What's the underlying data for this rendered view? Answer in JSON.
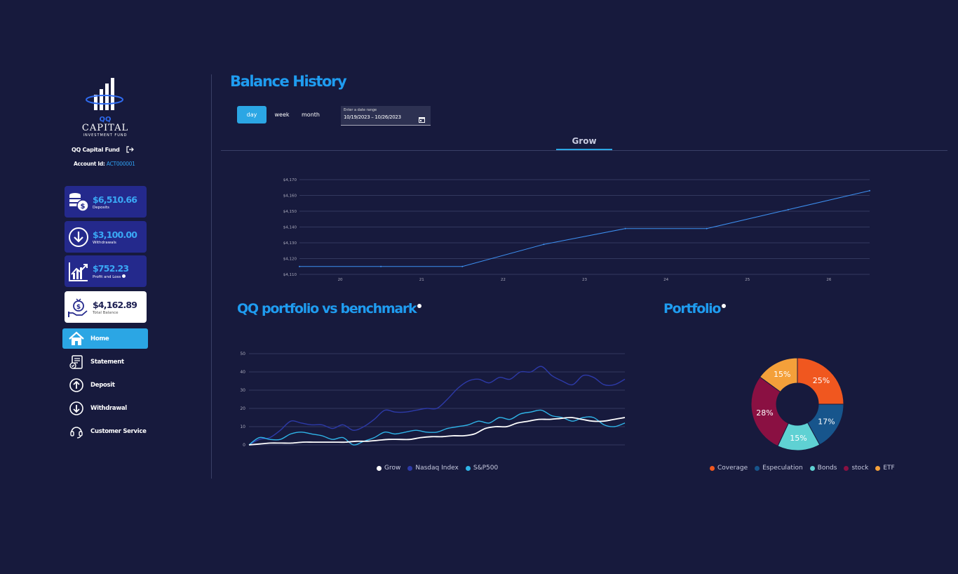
{
  "sidebar": {
    "brand_main": "CAPITAL",
    "brand_sub": "INVESTMENT FUND",
    "logo_letters": "QQ",
    "fund_name": "QQ Capital Fund",
    "account_label": "Account Id:",
    "account_id": "ACT000001",
    "stats": [
      {
        "amount": "$6,510.66",
        "label": "Deposits",
        "icon": "coins-dollar-icon"
      },
      {
        "amount": "$3,100.00",
        "label": "Withdrawals",
        "icon": "download-circle-icon"
      },
      {
        "amount": "$752.23",
        "label": "Profit and Loss",
        "icon": "growth-chart-icon"
      },
      {
        "amount": "$4,162.89",
        "label": "Total Balance",
        "icon": "money-bag-hand-icon"
      }
    ],
    "nav": [
      {
        "label": "Home",
        "icon": "home-icon",
        "active": true
      },
      {
        "label": "Statement",
        "icon": "statement-icon",
        "active": false
      },
      {
        "label": "Deposit",
        "icon": "upload-circle-icon",
        "active": false
      },
      {
        "label": "Withdrawal",
        "icon": "download-circle-icon",
        "active": false
      },
      {
        "label": "Customer Service",
        "icon": "headset-icon",
        "active": false
      }
    ]
  },
  "main": {
    "title": "Balance History",
    "periods": [
      "day",
      "week",
      "month"
    ],
    "active_period": "day",
    "date_range": {
      "label": "Enter a date range",
      "value": "10/19/2023 – 10/26/2023"
    },
    "tabs": [
      "Grow"
    ],
    "active_tab": "Grow",
    "benchmark_title": "QQ portfolio vs benchmark",
    "portfolio_title": "Portfolio"
  },
  "colors": {
    "accent": "#1f9cf0",
    "active_button": "#2ba6e4",
    "background": "#171a3d",
    "card": "#24298c"
  },
  "chart_data": [
    {
      "type": "line",
      "x": [
        "20",
        "21",
        "22",
        "23",
        "24",
        "25",
        "26"
      ],
      "series": [
        {
          "values": [
            4115,
            4115,
            4115,
            4129,
            4139,
            4139,
            4151,
            4163
          ]
        }
      ],
      "y_ticks": [
        "$4,110",
        "$4,120",
        "$4,130",
        "$4,140",
        "$4,150",
        "$4,160",
        "$4,170"
      ],
      "ylim": [
        4110,
        4170
      ],
      "grid": true,
      "color": "#3d8ff0"
    },
    {
      "type": "line",
      "y_ticks": [
        "0",
        "10",
        "20",
        "30",
        "40",
        "50"
      ],
      "ylim": [
        0,
        50
      ],
      "grid": true,
      "legend": "bottom",
      "series": [
        {
          "name": "Grow",
          "color": "#ffffff",
          "values": [
            0,
            0.5,
            1,
            1,
            1,
            1.5,
            1.5,
            1.5,
            1.5,
            1.5,
            2,
            2,
            2.5,
            3,
            3,
            3,
            4,
            4.5,
            4.5,
            5,
            5,
            6,
            9,
            10,
            10,
            12,
            13,
            14,
            14,
            14.5,
            15,
            14,
            13,
            13,
            14,
            15
          ]
        },
        {
          "name": "Nasdaq Index",
          "color": "#2d3aa8",
          "values": [
            0,
            3,
            4,
            8,
            13,
            12,
            11,
            11,
            9,
            11,
            8,
            10,
            14,
            19,
            18,
            18,
            19,
            20,
            20,
            25,
            31,
            35,
            36,
            34,
            37,
            36,
            40,
            40,
            43,
            38,
            35,
            33,
            38,
            37,
            33,
            33,
            36
          ]
        },
        {
          "name": "S&P500",
          "color": "#2fb4e8",
          "values": [
            0,
            4,
            3,
            3,
            6,
            7,
            6,
            5,
            3,
            4,
            0,
            2,
            4,
            7,
            6,
            7,
            8,
            7,
            7,
            9,
            10,
            11,
            13,
            12,
            15,
            14,
            17,
            18,
            19,
            16,
            15,
            13,
            15,
            15,
            11,
            10,
            12
          ]
        }
      ]
    },
    {
      "type": "pie",
      "legend": "bottom",
      "slices": [
        {
          "name": "Coverage",
          "value": 25,
          "label": "25%",
          "color": "#f0571f"
        },
        {
          "name": "Especulation",
          "value": 17,
          "label": "17%",
          "color": "#17558c"
        },
        {
          "name": "Bonds",
          "value": 15,
          "label": "15%",
          "color": "#5fd1d3"
        },
        {
          "name": "stock",
          "value": 28,
          "label": "28%",
          "color": "#8a1042"
        },
        {
          "name": "ETF",
          "value": 15,
          "label": "15%",
          "color": "#f4a03a"
        }
      ]
    }
  ]
}
